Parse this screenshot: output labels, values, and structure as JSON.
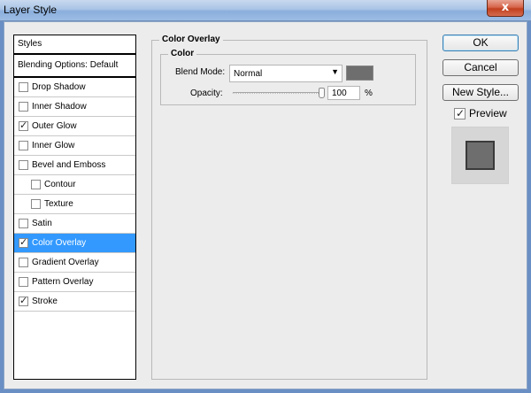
{
  "window": {
    "title": "Layer Style",
    "close_glyph": "x"
  },
  "sidebar": {
    "header": "Styles",
    "blending_options": "Blending Options: Default",
    "items": [
      {
        "label": "Drop Shadow",
        "checked": false,
        "indent": false,
        "selected": false
      },
      {
        "label": "Inner Shadow",
        "checked": false,
        "indent": false,
        "selected": false
      },
      {
        "label": "Outer Glow",
        "checked": true,
        "indent": false,
        "selected": false
      },
      {
        "label": "Inner Glow",
        "checked": false,
        "indent": false,
        "selected": false
      },
      {
        "label": "Bevel and Emboss",
        "checked": false,
        "indent": false,
        "selected": false
      },
      {
        "label": "Contour",
        "checked": false,
        "indent": true,
        "selected": false
      },
      {
        "label": "Texture",
        "checked": false,
        "indent": true,
        "selected": false
      },
      {
        "label": "Satin",
        "checked": false,
        "indent": false,
        "selected": false
      },
      {
        "label": "Color Overlay",
        "checked": true,
        "indent": false,
        "selected": true
      },
      {
        "label": "Gradient Overlay",
        "checked": false,
        "indent": false,
        "selected": false
      },
      {
        "label": "Pattern Overlay",
        "checked": false,
        "indent": false,
        "selected": false
      },
      {
        "label": "Stroke",
        "checked": true,
        "indent": false,
        "selected": false
      }
    ]
  },
  "panel": {
    "title": "Color Overlay",
    "group_title": "Color",
    "blend_mode_label": "Blend Mode:",
    "blend_mode_value": "Normal",
    "overlay_color": "#6e6e6e",
    "opacity_label": "Opacity:",
    "opacity_value": "100",
    "opacity_unit": "%",
    "opacity_fraction": 1.0
  },
  "buttons": {
    "ok": "OK",
    "cancel": "Cancel",
    "new_style": "New Style..."
  },
  "preview": {
    "label": "Preview",
    "checked": true
  },
  "colors": {
    "selection": "#3399ff",
    "dialog_bg": "#ececec"
  }
}
